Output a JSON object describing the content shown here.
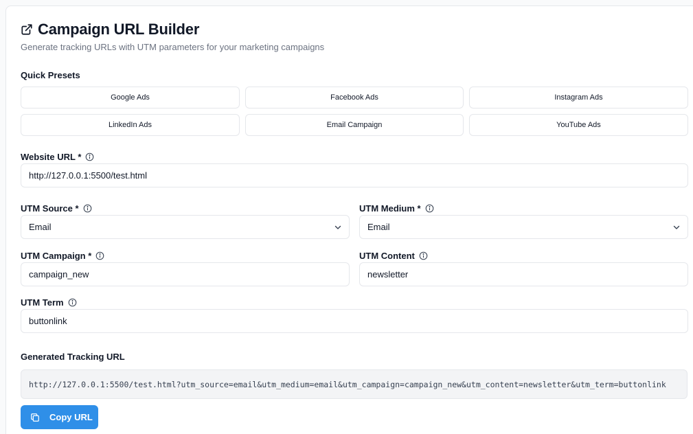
{
  "header": {
    "title": "Campaign URL Builder",
    "subtitle": "Generate tracking URLs with UTM parameters for your marketing campaigns",
    "icon": "external-link-icon"
  },
  "presets": {
    "label": "Quick Presets",
    "items": [
      {
        "label": "Google Ads"
      },
      {
        "label": "Facebook Ads"
      },
      {
        "label": "Instagram Ads"
      },
      {
        "label": "LinkedIn Ads"
      },
      {
        "label": "Email Campaign"
      },
      {
        "label": "YouTube Ads"
      }
    ]
  },
  "fields": {
    "website_url": {
      "label": "Website URL *",
      "value": "http://127.0.0.1:5500/test.html"
    },
    "utm_source": {
      "label": "UTM Source *",
      "value": "Email"
    },
    "utm_medium": {
      "label": "UTM Medium *",
      "value": "Email"
    },
    "utm_campaign": {
      "label": "UTM Campaign *",
      "value": "campaign_new"
    },
    "utm_content": {
      "label": "UTM Content",
      "value": "newsletter"
    },
    "utm_term": {
      "label": "UTM Term",
      "value": "buttonlink"
    }
  },
  "output": {
    "label": "Generated Tracking URL",
    "url": "http://127.0.0.1:5500/test.html?utm_source=email&utm_medium=email&utm_campaign=campaign_new&utm_content=newsletter&utm_term=buttonlink",
    "copy_label": "Copy URL"
  },
  "colors": {
    "accent": "#2f8fe8",
    "border": "#e5e7eb",
    "muted_text": "#6b7280",
    "output_bg": "#f3f4f6"
  }
}
